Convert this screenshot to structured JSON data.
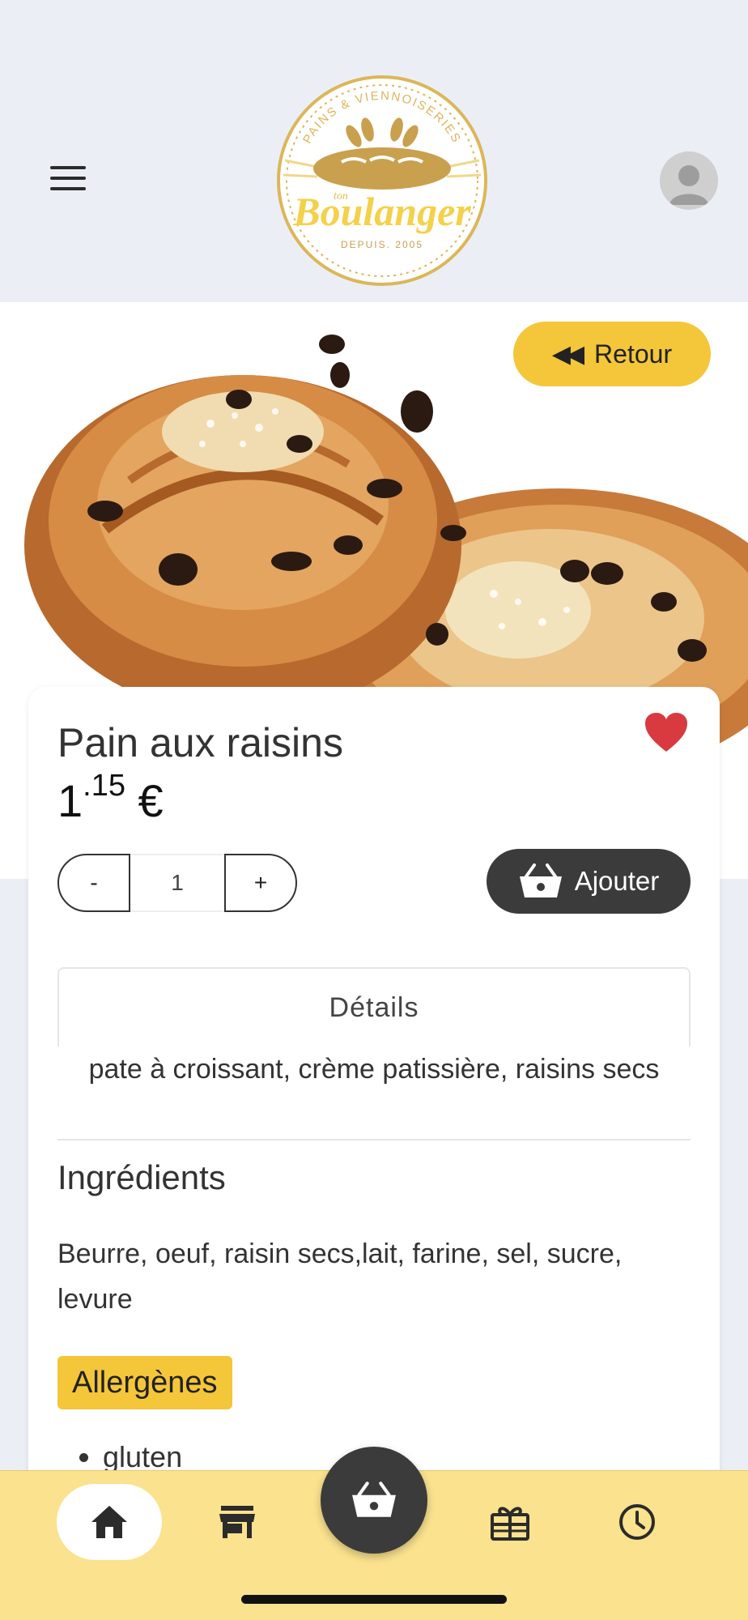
{
  "header": {
    "logo": {
      "arc_text": "PAINS & VIENNOISERIES",
      "small_text": "ton",
      "brand": "Boulanger",
      "since": "DEPUIS. 2005"
    }
  },
  "hero": {
    "back_label": "Retour"
  },
  "product": {
    "name": "Pain aux raisins",
    "price_int": "1",
    "price_cents": ".15",
    "currency": "€",
    "quantity": "1",
    "minus_label": "-",
    "plus_label": "+",
    "add_label": "Ajouter",
    "favorite": true
  },
  "details": {
    "header": "Détails",
    "description": "pate à croissant, crème patissière, raisins secs"
  },
  "ingredients": {
    "title": "Ingrédients",
    "text": "Beurre, oeuf, raisin secs,lait, farine, sel, sucre, levure"
  },
  "allergens": {
    "title": "Allergènes",
    "items": [
      "gluten"
    ]
  },
  "nav": {
    "items": [
      "home-icon",
      "shop-icon",
      "cart-icon",
      "gift-icon",
      "history-icon"
    ],
    "active": "home-icon"
  },
  "colors": {
    "accent": "#f4c63a",
    "dark": "#3b3b3b",
    "nav_bg": "#fae28e",
    "heart": "#d93a3f",
    "page_bg": "#ebeff5"
  }
}
